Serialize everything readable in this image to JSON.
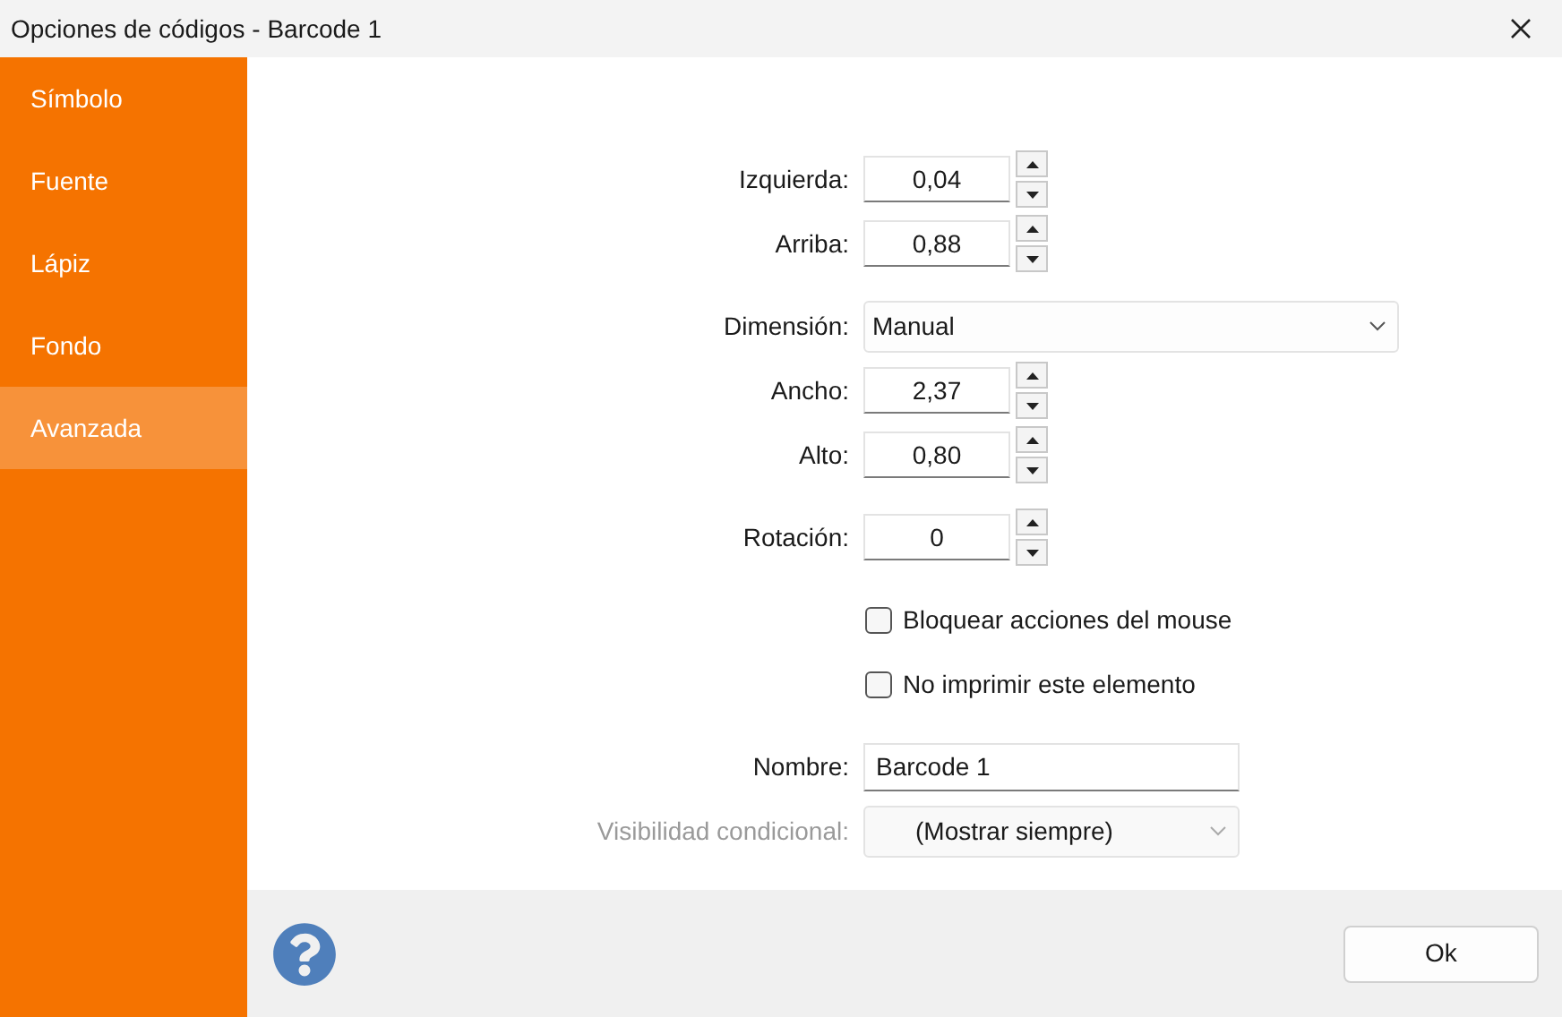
{
  "window": {
    "title": "Opciones de códigos - Barcode 1"
  },
  "sidebar": {
    "items": [
      {
        "label": "Símbolo",
        "selected": false
      },
      {
        "label": "Fuente",
        "selected": false
      },
      {
        "label": "Lápiz",
        "selected": false
      },
      {
        "label": "Fondo",
        "selected": false
      },
      {
        "label": "Avanzada",
        "selected": true
      }
    ]
  },
  "form": {
    "groups": [
      [
        {
          "kind": "spin",
          "label": "Izquierda:",
          "value": "0,04",
          "disabled": false
        },
        {
          "kind": "spin",
          "label": "Arriba:",
          "value": "0,88",
          "disabled": false
        }
      ],
      [
        {
          "kind": "dropdown",
          "label": "Dimensión:",
          "value": "Manual",
          "disabled": false
        },
        {
          "kind": "spin",
          "label": "Ancho:",
          "value": "2,37",
          "disabled": false
        },
        {
          "kind": "spin",
          "label": "Alto:",
          "value": "0,80",
          "disabled": false
        }
      ],
      [
        {
          "kind": "spin",
          "label": "Rotación:",
          "value": "0",
          "disabled": false
        }
      ],
      [
        {
          "kind": "checkbox",
          "label": "Bloquear acciones del mouse",
          "checked": false,
          "disabled": false
        },
        {
          "kind": "checkbox",
          "label": "No imprimir este elemento",
          "checked": false,
          "disabled": false
        }
      ],
      [
        {
          "kind": "text",
          "label": "Nombre:",
          "value": "Barcode 1",
          "disabled": false
        },
        {
          "kind": "select",
          "label": "Visibilidad condicional:",
          "value": "(Mostrar siempre)",
          "disabled": true
        }
      ]
    ]
  },
  "footer": {
    "ok_button": "Ok"
  }
}
